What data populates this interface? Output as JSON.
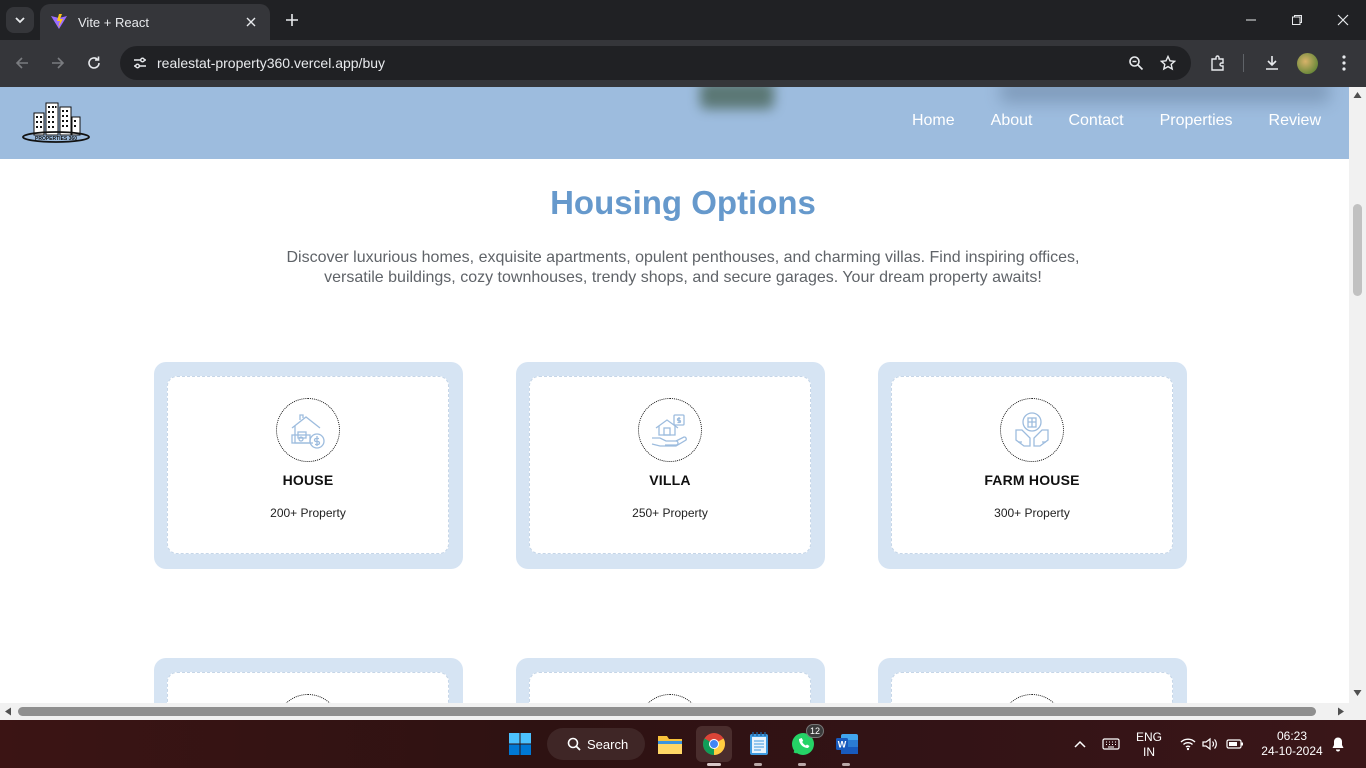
{
  "browser": {
    "tab_title": "Vite + React",
    "url": "realestat-property360.vercel.app/buy"
  },
  "site": {
    "logo_text": "PROPERTIES 360",
    "nav": [
      {
        "label": "Home"
      },
      {
        "label": "About"
      },
      {
        "label": "Contact"
      },
      {
        "label": "Properties"
      },
      {
        "label": "Review"
      }
    ],
    "section_title": "Housing Options",
    "section_intro": "Discover luxurious homes, exquisite apartments, opulent penthouses, and charming villas. Find inspiring offices, versatile buildings, cozy townhouses, trendy shops, and secure garages. Your dream property awaits!",
    "cards": [
      {
        "title": "HOUSE",
        "count": "200+ Property",
        "icon": "house-money-icon"
      },
      {
        "title": "VILLA",
        "count": "250+ Property",
        "icon": "villa-hand-icon"
      },
      {
        "title": "FARM HOUSE",
        "count": "300+ Property",
        "icon": "farmhouse-hands-icon"
      }
    ],
    "accent_color": "#6699cc",
    "header_color": "#9dbcde",
    "card_color": "#d6e4f3"
  },
  "taskbar": {
    "search_label": "Search",
    "whatsapp_badge": "12",
    "lang_line1": "ENG",
    "lang_line2": "IN",
    "time": "06:23",
    "date": "24-10-2024"
  }
}
